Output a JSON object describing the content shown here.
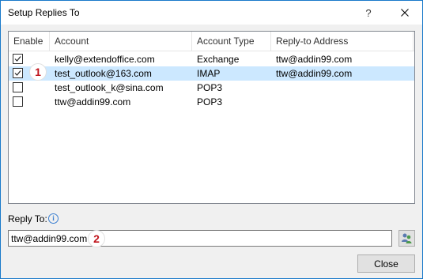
{
  "window": {
    "title": "Setup Replies To",
    "help_glyph": "?",
    "close_icon": "close-icon"
  },
  "table": {
    "columns": [
      "Enable",
      "Account",
      "Account Type",
      "Reply-to Address"
    ],
    "rows": [
      {
        "enabled": true,
        "account": "kelly@extendoffice.com",
        "type": "Exchange",
        "reply_to": "ttw@addin99.com",
        "selected": false
      },
      {
        "enabled": true,
        "account": "test_outlook@163.com",
        "type": "IMAP",
        "reply_to": "ttw@addin99.com",
        "selected": true
      },
      {
        "enabled": false,
        "account": "test_outlook_k@sina.com",
        "type": "POP3",
        "reply_to": "",
        "selected": false
      },
      {
        "enabled": false,
        "account": "ttw@addin99.com",
        "type": "POP3",
        "reply_to": "",
        "selected": false
      }
    ]
  },
  "reply_to": {
    "label": "Reply To:",
    "info_icon": "info-icon",
    "value": "ttw@addin99.com",
    "address_book_icon": "address-book-icon"
  },
  "annotations": {
    "step1": "1",
    "step2": "2"
  },
  "buttons": {
    "close": "Close"
  },
  "colors": {
    "selection": "#cce8ff",
    "badge_text": "#c0141b",
    "window_border": "#1979ca"
  }
}
